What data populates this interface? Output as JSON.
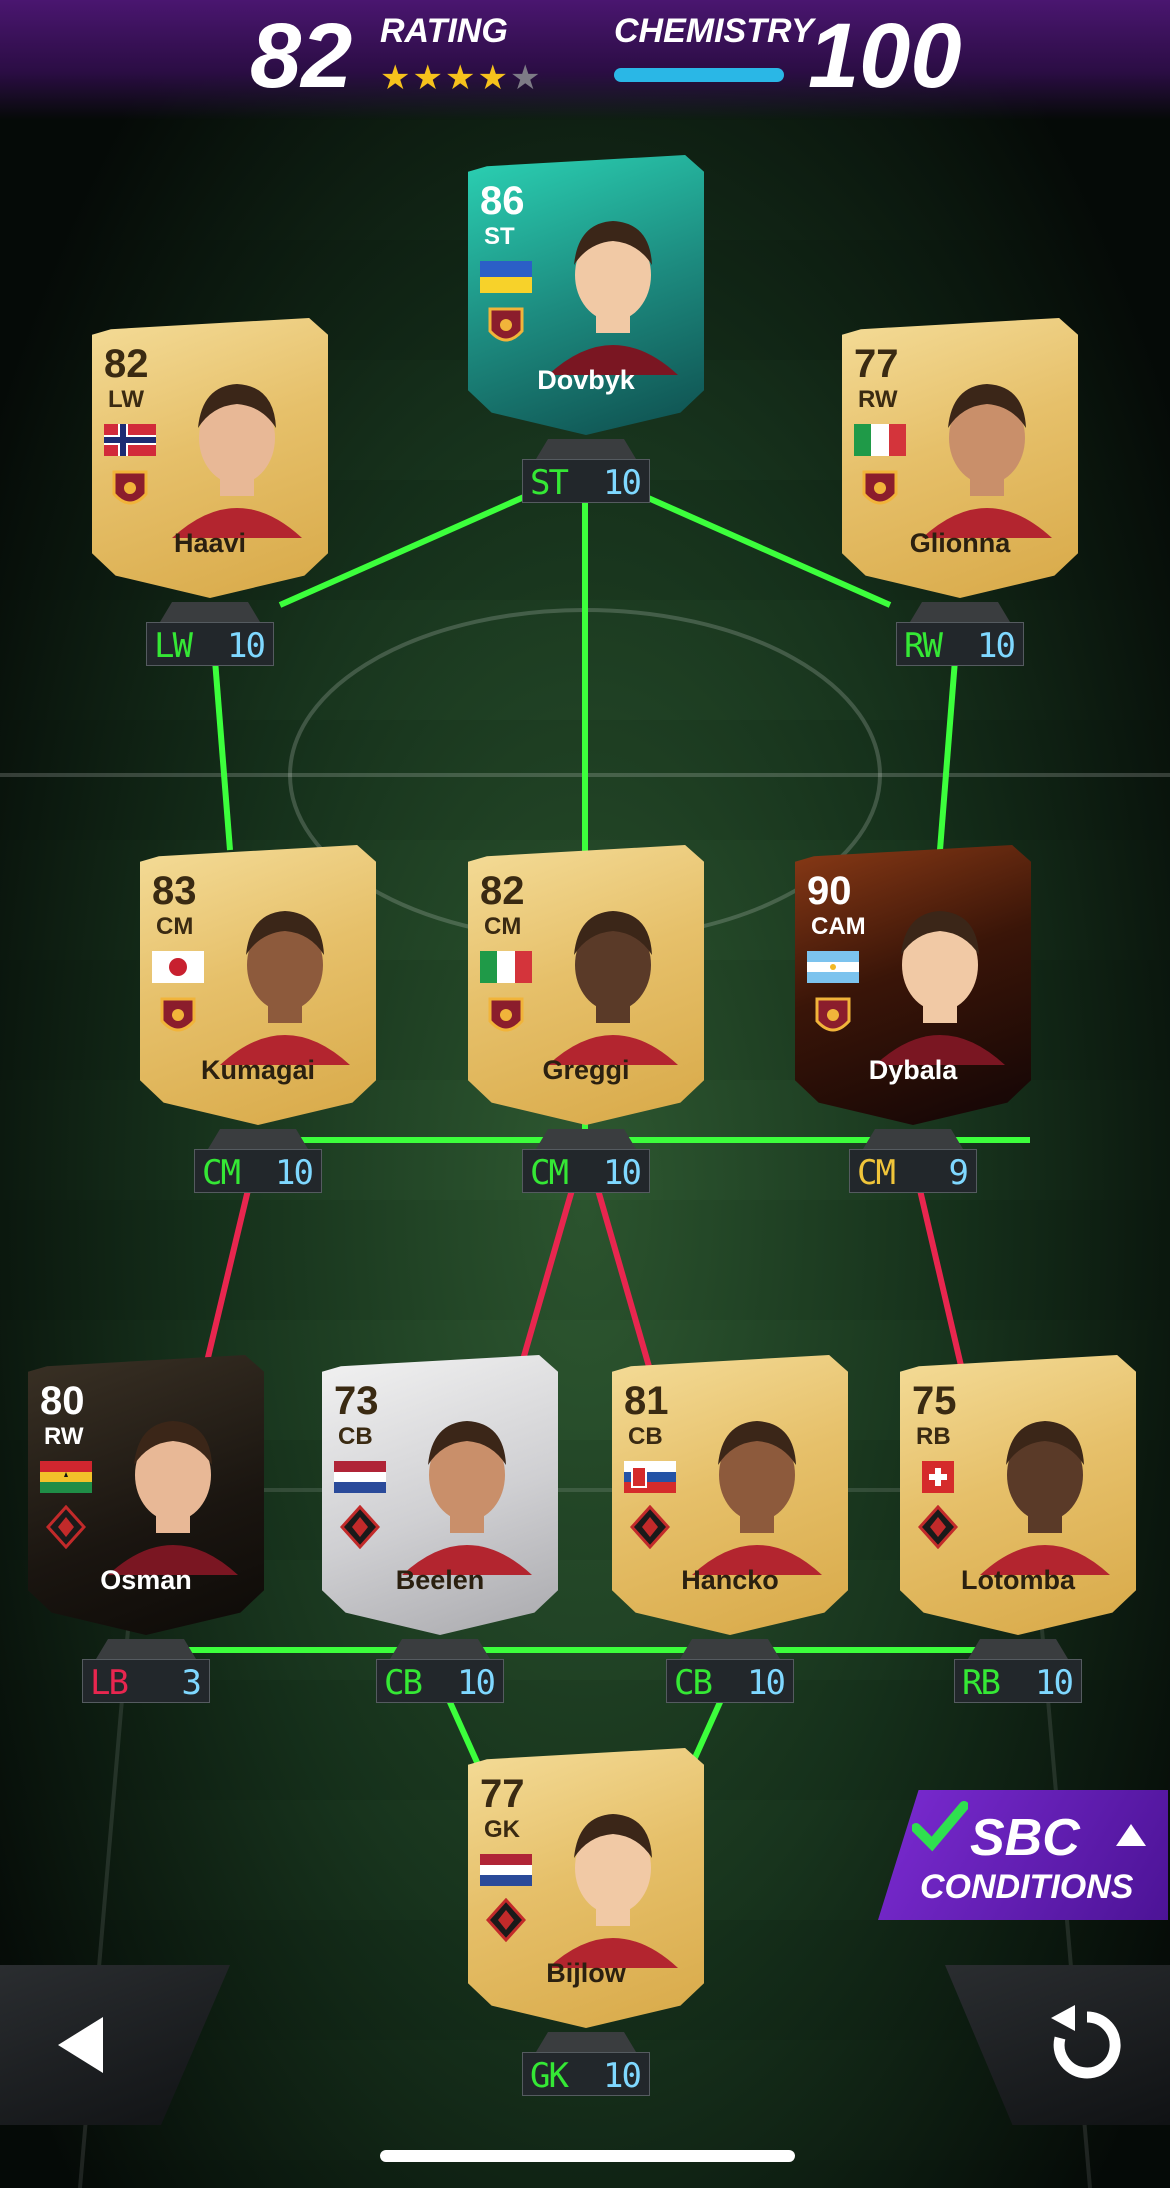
{
  "header": {
    "rating_value": "82",
    "rating_label": "RATING",
    "stars_filled": 4,
    "stars_total": 5,
    "chemistry_label": "CHEMISTRY",
    "chemistry_value": "100"
  },
  "players": [
    {
      "id": "dovbyk",
      "name": "Dovbyk",
      "rating": "86",
      "position": "ST",
      "style": "special",
      "flag": "ukraine",
      "club": "roma-crest",
      "slot": "ST",
      "chem": "10",
      "slot_color": "#35e835"
    },
    {
      "id": "haavi",
      "name": "Haavi",
      "rating": "82",
      "position": "LW",
      "style": "gold",
      "flag": "norway",
      "club": "roma-crest",
      "slot": "LW",
      "chem": "10",
      "slot_color": "#35e835"
    },
    {
      "id": "glionna",
      "name": "Glionna",
      "rating": "77",
      "position": "RW",
      "style": "gold",
      "flag": "italy",
      "club": "roma-crest",
      "slot": "RW",
      "chem": "10",
      "slot_color": "#35e835"
    },
    {
      "id": "kumagai",
      "name": "Kumagai",
      "rating": "83",
      "position": "CM",
      "style": "gold",
      "flag": "japan",
      "club": "roma-crest",
      "slot": "CM",
      "chem": "10",
      "slot_color": "#35e835"
    },
    {
      "id": "greggi",
      "name": "Greggi",
      "rating": "82",
      "position": "CM",
      "style": "gold",
      "flag": "italy",
      "club": "roma-crest",
      "slot": "CM",
      "chem": "10",
      "slot_color": "#35e835"
    },
    {
      "id": "dybala",
      "name": "Dybala",
      "rating": "90",
      "position": "CAM",
      "style": "uel",
      "flag": "argentina",
      "club": "roma-crest",
      "slot": "CM",
      "chem": "9",
      "slot_color": "#f0c53a"
    },
    {
      "id": "osman",
      "name": "Osman",
      "rating": "80",
      "position": "RW",
      "style": "totw",
      "flag": "ghana",
      "club": "club-badge",
      "slot": "LB",
      "chem": "3",
      "slot_color": "#e8264f"
    },
    {
      "id": "beelen",
      "name": "Beelen",
      "rating": "73",
      "position": "CB",
      "style": "silver",
      "flag": "netherlands",
      "club": "club-badge",
      "slot": "CB",
      "chem": "10",
      "slot_color": "#35e835"
    },
    {
      "id": "hancko",
      "name": "Hancko",
      "rating": "81",
      "position": "CB",
      "style": "gold",
      "flag": "slovakia",
      "club": "club-badge",
      "slot": "CB",
      "chem": "10",
      "slot_color": "#35e835"
    },
    {
      "id": "lotomba",
      "name": "Lotomba",
      "rating": "75",
      "position": "RB",
      "style": "gold",
      "flag": "switzerland",
      "club": "club-badge",
      "slot": "RB",
      "chem": "10",
      "slot_color": "#35e835"
    },
    {
      "id": "bijlow",
      "name": "Bijlow",
      "rating": "77",
      "position": "GK",
      "style": "gold",
      "flag": "netherlands",
      "club": "club-badge",
      "slot": "GK",
      "chem": "10",
      "slot_color": "#35e835"
    }
  ],
  "sbc": {
    "line1": "SBC",
    "line2": "CONDITIONS"
  },
  "nav": {
    "back_icon": "back-arrow-icon",
    "reset_icon": "reset-icon"
  },
  "colors": {
    "good_link": "#3cff3c",
    "bad_link": "#e8264f",
    "accent": "#7b2bd2",
    "chem_bar": "#2ab7e6"
  }
}
